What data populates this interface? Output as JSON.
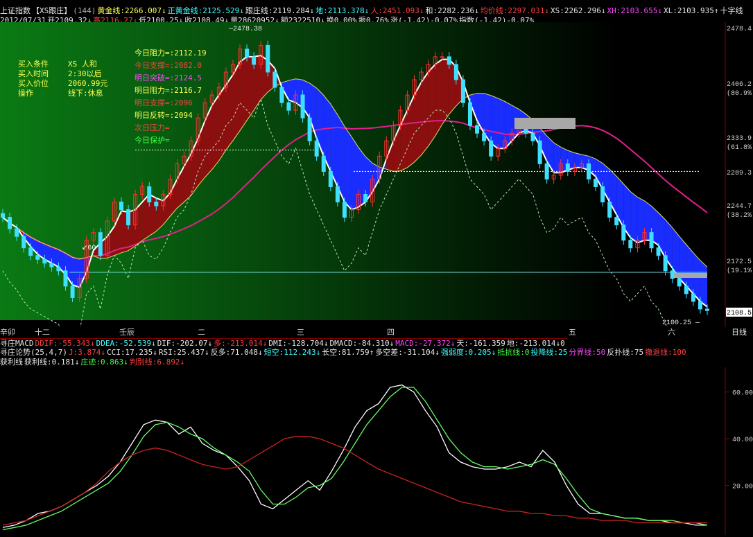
{
  "header": {
    "line1": [
      {
        "t": "上证指数",
        "c": "c-w"
      },
      {
        "t": "【XS跟庄】",
        "c": "c-w"
      },
      {
        "t": "(144)",
        "c": "c-gy"
      },
      {
        "t": "黄金线:2266.007↓",
        "c": "c-y"
      },
      {
        "t": "正黄金线:2125.529↓",
        "c": "c-c"
      },
      {
        "t": "跟庄线:2119.284↓",
        "c": "c-w"
      },
      {
        "t": "地:2113.378↓",
        "c": "c-c"
      },
      {
        "t": "人:2451.093↓",
        "c": "c-r"
      },
      {
        "t": "和:2282.236↓",
        "c": "c-w"
      },
      {
        "t": "均价线:2297.031↓",
        "c": "c-r"
      },
      {
        "t": "XS:2262.296↓",
        "c": "c-w"
      },
      {
        "t": "XH:2103.655↓",
        "c": "c-m"
      },
      {
        "t": "XL:2103.935↑",
        "c": "c-w"
      },
      {
        "t": "十字线",
        "c": "c-w"
      }
    ],
    "line2": [
      {
        "t": "2012/07/31",
        "c": "c-w"
      },
      {
        "t": "开2109.32↓",
        "c": "c-w"
      },
      {
        "t": "高2116.27↓",
        "c": "c-r"
      },
      {
        "t": "低2100.25↓",
        "c": "c-w"
      },
      {
        "t": "收2108.49↓",
        "c": "c-w"
      },
      {
        "t": "量28620952↓",
        "c": "c-w"
      },
      {
        "t": "额2322510↓",
        "c": "c-w"
      },
      {
        "t": "换0.00%",
        "c": "c-w"
      },
      {
        "t": "振0.76%",
        "c": "c-w"
      },
      {
        "t": "涨(-1.42)-0.07%",
        "c": "c-w"
      },
      {
        "t": "指数(-1.42)-0.07%",
        "c": "c-w"
      }
    ]
  },
  "info_box": [
    {
      "label": "买入条件",
      "value": "XS 人和",
      "c": "c-y"
    },
    {
      "label": "买入时间",
      "value": "2:30以后",
      "c": "c-y"
    },
    {
      "label": "买入价位",
      "value": "2060.99元",
      "c": "c-y"
    },
    {
      "label": "操作",
      "value": "线下:休息",
      "c": "c-y"
    }
  ],
  "resistance_labels": [
    {
      "t": "今日阻力=:2112.19",
      "c": "c-y"
    },
    {
      "t": "今日支撑=:2082.0",
      "c": "c-r"
    },
    {
      "t": "明日突破=:2124.5",
      "c": "c-m"
    },
    {
      "t": "明日阻力=:2116.7",
      "c": "c-y"
    },
    {
      "t": "明日支撑=:2096",
      "c": "c-r"
    },
    {
      "t": "明日反转=:2094",
      "c": "c-y"
    },
    {
      "t": "次日压力=",
      "c": "c-r"
    },
    {
      "t": "今日保护=",
      "c": "c-g"
    }
  ],
  "main_axis": [
    {
      "v": "2478.4",
      "pct": ""
    },
    {
      "v": "2406.2",
      "pct": "(80.9%)"
    },
    {
      "v": "2333.9",
      "pct": "(61.8%)"
    },
    {
      "v": "2289.3",
      "pct": ""
    },
    {
      "v": "2244.7",
      "pct": "(38.2%)"
    },
    {
      "v": "2172.5",
      "pct": "(19.1%)"
    },
    {
      "v": "2108.5",
      "pct": ""
    }
  ],
  "chart_labels": {
    "high": "2478.38",
    "low": "2100.25",
    "mark": "60"
  },
  "date_axis": [
    "辛卯",
    "十二",
    "壬辰",
    "二",
    "三",
    "四",
    "五",
    "六",
    "日线"
  ],
  "macd_row": [
    {
      "t": "寻庄MACD",
      "c": "c-w"
    },
    {
      "t": "DDIF:-55.343↓",
      "c": "c-r"
    },
    {
      "t": "DDEA:-52.539↓",
      "c": "c-c"
    },
    {
      "t": "DIF:-202.07↓",
      "c": "c-w"
    },
    {
      "t": "多:-213.014↓",
      "c": "c-r"
    },
    {
      "t": "DMI:-128.704↓",
      "c": "c-w"
    },
    {
      "t": "DMACD:-84.310↓",
      "c": "c-w"
    },
    {
      "t": "MACD:-27.372↓",
      "c": "c-m"
    },
    {
      "t": "天:-161.359",
      "c": "c-w"
    },
    {
      "t": "地:-213.014↓0",
      "c": "c-w"
    }
  ],
  "lun_row": [
    {
      "t": "寻庄论势(25,4,7)",
      "c": "c-w"
    },
    {
      "t": "J:3.874↓",
      "c": "c-r"
    },
    {
      "t": "CCI:17.235↓",
      "c": "c-w"
    },
    {
      "t": "RSI:25.437↓",
      "c": "c-w"
    },
    {
      "t": "反多:71.048↓",
      "c": "c-w"
    },
    {
      "t": "短空:112.243↓",
      "c": "c-c"
    },
    {
      "t": "长空:81.759↑",
      "c": "c-w"
    },
    {
      "t": "多空差:-31.104↓",
      "c": "c-w"
    },
    {
      "t": "强弱度:0.205↓",
      "c": "c-c"
    },
    {
      "t": "抵抗线:0",
      "c": "c-g"
    },
    {
      "t": "投降线:25",
      "c": "c-c"
    },
    {
      "t": "分界线:50",
      "c": "c-m"
    },
    {
      "t": "反扑线:75",
      "c": "c-w"
    },
    {
      "t": "撤退线:100",
      "c": "c-r"
    }
  ],
  "yin_row": [
    {
      "t": "获利线",
      "c": "c-w"
    },
    {
      "t": "获利线:0.181↓",
      "c": "c-w"
    },
    {
      "t": "庄迹:0.863↓",
      "c": "c-g"
    },
    {
      "t": "判别线:6.892↓",
      "c": "c-r"
    }
  ],
  "osc_axis": [
    "60.00",
    "40.00",
    "20.00"
  ],
  "chart_data": {
    "type": "line",
    "price_axis": {
      "ylim": [
        2100,
        2478
      ]
    },
    "candles_close": [
      2230,
      2215,
      2205,
      2190,
      2180,
      2175,
      2170,
      2165,
      2160,
      2140,
      2125,
      2150,
      2200,
      2210,
      2180,
      2225,
      2250,
      2240,
      2220,
      2260,
      2270,
      2250,
      2245,
      2260,
      2280,
      2300,
      2310,
      2330,
      2360,
      2380,
      2390,
      2400,
      2420,
      2430,
      2450,
      2440,
      2430,
      2455,
      2420,
      2400,
      2380,
      2370,
      2390,
      2360,
      2330,
      2310,
      2290,
      2270,
      2250,
      2230,
      2240,
      2260,
      2250,
      2280,
      2310,
      2330,
      2350,
      2370,
      2390,
      2410,
      2420,
      2430,
      2440,
      2440,
      2430,
      2410,
      2380,
      2350,
      2340,
      2330,
      2310,
      2320,
      2330,
      2340,
      2350,
      2340,
      2330,
      2300,
      2280,
      2285,
      2300,
      2290,
      2295,
      2300,
      2280,
      2270,
      2250,
      2230,
      2220,
      2200,
      2190,
      2200,
      2210,
      2190,
      2180,
      2160,
      2150,
      2140,
      2130,
      2120,
      2110,
      2108
    ],
    "osc_axis_range": [
      0,
      70
    ],
    "osc_series": [
      {
        "name": "获利线",
        "color": "#ffffff",
        "values": [
          2,
          3,
          5,
          8,
          9,
          11,
          14,
          17,
          20,
          24,
          30,
          38,
          46,
          48,
          47,
          42,
          45,
          38,
          35,
          33,
          28,
          22,
          12,
          10,
          14,
          18,
          22,
          18,
          26,
          35,
          45,
          52,
          55,
          62,
          63,
          60,
          52,
          45,
          34,
          30,
          28,
          27,
          27,
          28,
          30,
          28,
          35,
          30,
          20,
          12,
          8,
          8,
          7,
          6,
          6,
          5,
          5,
          4,
          4,
          3,
          3
        ]
      },
      {
        "name": "庄迹",
        "color": "#66ff66",
        "values": [
          1,
          2,
          3,
          5,
          7,
          9,
          12,
          15,
          18,
          21,
          26,
          33,
          41,
          46,
          47,
          45,
          42,
          40,
          36,
          33,
          30,
          26,
          18,
          12,
          12,
          15,
          19,
          20,
          23,
          30,
          38,
          46,
          52,
          58,
          62,
          62,
          56,
          48,
          40,
          34,
          30,
          28,
          28,
          27,
          28,
          29,
          31,
          29,
          23,
          16,
          10,
          8,
          7,
          6,
          6,
          5,
          5,
          5,
          4,
          4,
          3
        ]
      },
      {
        "name": "判别线",
        "color": "#cc2222",
        "values": [
          3,
          4,
          5,
          7,
          9,
          11,
          14,
          17,
          21,
          26,
          30,
          33,
          35,
          36,
          35,
          33,
          31,
          29,
          28,
          27,
          28,
          31,
          34,
          37,
          40,
          41,
          41,
          40,
          38,
          36,
          33,
          30,
          27,
          25,
          23,
          21,
          19,
          17,
          15,
          13,
          12,
          11,
          10,
          9,
          9,
          8,
          8,
          7,
          7,
          6,
          6,
          5,
          5,
          5,
          4,
          4,
          4,
          4,
          4,
          4,
          4
        ]
      }
    ]
  }
}
